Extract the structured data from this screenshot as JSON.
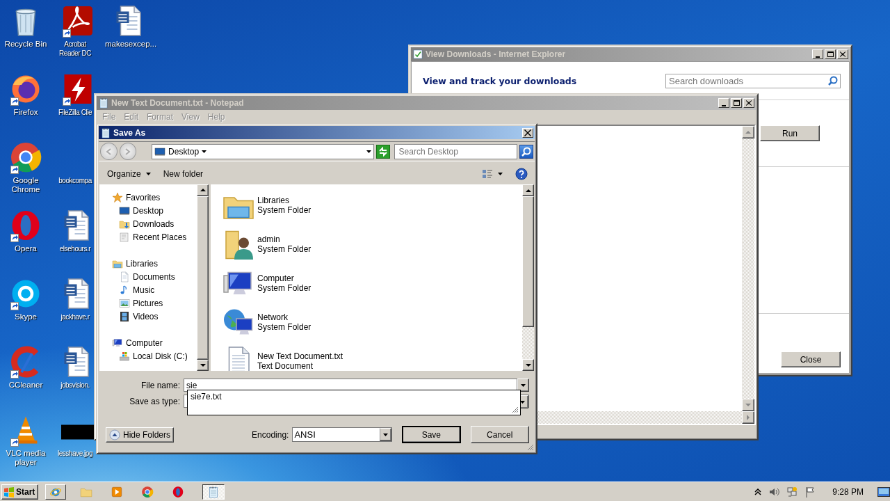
{
  "desktop": {
    "columns": [
      [
        {
          "label": "Recycle Bin",
          "kind": "recycle",
          "shortcut": false
        },
        {
          "label": "Firefox",
          "kind": "firefox",
          "shortcut": true
        },
        {
          "label": "Google Chrome",
          "kind": "chrome",
          "shortcut": true
        },
        {
          "label": "Opera",
          "kind": "opera",
          "shortcut": true
        },
        {
          "label": "Skype",
          "kind": "skype",
          "shortcut": true
        },
        {
          "label": "CCleaner",
          "kind": "ccleaner",
          "shortcut": true
        },
        {
          "label": "VLC media player",
          "kind": "vlc",
          "shortcut": true
        }
      ],
      [
        {
          "label": "Acrobat Reader DC",
          "kind": "acrobat",
          "shortcut": true
        },
        {
          "label": "FileZilla Clie",
          "kind": "filezilla",
          "shortcut": true
        },
        {
          "label": "bookcompa",
          "kind": "blank",
          "shortcut": false
        },
        {
          "label": "elsehours.r",
          "kind": "word",
          "shortcut": false
        },
        {
          "label": "jackhave.r",
          "kind": "word",
          "shortcut": false
        },
        {
          "label": "jobsvision.",
          "kind": "word",
          "shortcut": false
        },
        {
          "label": "lesshave.jpg",
          "kind": "image",
          "shortcut": false
        }
      ],
      [
        {
          "label": "makesexcep...",
          "kind": "word",
          "shortcut": false
        }
      ]
    ]
  },
  "ie_window": {
    "title": "View Downloads - Internet Explorer",
    "heading": "View and track your downloads",
    "search": {
      "placeholder": "Search downloads"
    },
    "buttons": [
      {
        "label": "Run",
        "kind": "row"
      },
      {
        "label": "Close",
        "kind": "footer"
      }
    ]
  },
  "notepad": {
    "title": "New Text Document.txt - Notepad",
    "menu": [
      {
        "label": "File",
        "disabled": true
      },
      {
        "label": "Edit",
        "disabled": true
      },
      {
        "label": "Format",
        "disabled": true
      },
      {
        "label": "View",
        "disabled": true
      },
      {
        "label": "Help",
        "disabled": true
      }
    ]
  },
  "save_as": {
    "title": "Save As",
    "address": "Desktop",
    "search": {
      "placeholder": "Search Desktop"
    },
    "toolbar": [
      {
        "label": "Organize",
        "dropdown": true
      },
      {
        "label": "New folder",
        "dropdown": false
      }
    ],
    "nav": [
      {
        "label": "Favorites",
        "kind": "star",
        "children": [
          {
            "label": "Desktop",
            "kind": "desktop"
          },
          {
            "label": "Downloads",
            "kind": "downloads"
          },
          {
            "label": "Recent Places",
            "kind": "recent"
          }
        ]
      },
      {
        "label": "Libraries",
        "kind": "libraries",
        "children": [
          {
            "label": "Documents",
            "kind": "doc"
          },
          {
            "label": "Music",
            "kind": "music"
          },
          {
            "label": "Pictures",
            "kind": "pictures"
          },
          {
            "label": "Videos",
            "kind": "videos"
          }
        ]
      },
      {
        "label": "Computer",
        "kind": "computer",
        "children": [
          {
            "label": "Local Disk (C:)",
            "kind": "disk"
          }
        ]
      }
    ],
    "files": [
      {
        "name": "Libraries",
        "type": "System Folder",
        "kind": "libraries"
      },
      {
        "name": "admin",
        "type": "System Folder",
        "kind": "user"
      },
      {
        "name": "Computer",
        "type": "System Folder",
        "kind": "computer"
      },
      {
        "name": "Network",
        "type": "System Folder",
        "kind": "network"
      },
      {
        "name": "New Text Document.txt",
        "type": "Text Document",
        "kind": "text"
      }
    ],
    "file_name": {
      "label": "File name:",
      "value": "sie"
    },
    "autocomplete": [
      "sie7e.txt"
    ],
    "save_as_type": {
      "label": "Save as type:"
    },
    "hide_folders": "Hide Folders",
    "encoding": {
      "label": "Encoding:",
      "value": "ANSI"
    },
    "buttons": [
      {
        "label": "Save",
        "default": true
      },
      {
        "label": "Cancel",
        "default": false
      }
    ]
  },
  "taskbar": {
    "start": "Start",
    "quick_launch": [
      {
        "kind": "ie"
      },
      {
        "kind": "explorer"
      },
      {
        "kind": "media"
      },
      {
        "kind": "chrome"
      },
      {
        "kind": "opera"
      }
    ],
    "tasks": [
      {
        "kind": "notepad",
        "selected": true
      }
    ],
    "clock": "9:28 PM"
  }
}
